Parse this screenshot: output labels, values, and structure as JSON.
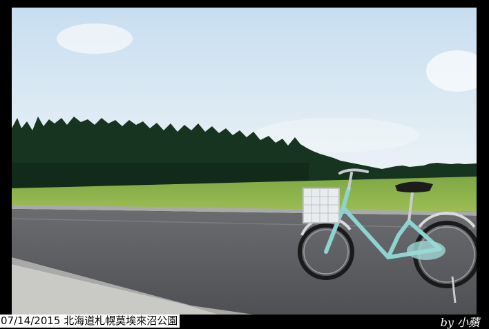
{
  "caption": {
    "text": "07/14/2015 北海道札幌莫埃來沼公園"
  },
  "signature": {
    "text": "by 小蘋"
  },
  "photo": {
    "colors": {
      "sky_top": "#d4e7f5",
      "sky_bottom": "#eef4f8",
      "trees": "#15301c",
      "grass": "#8db34a",
      "road": "#5a5c60",
      "sidewalk": "#c9c9c6",
      "bicycle_frame": "#8fd3cf",
      "basket": "#e8ecef",
      "tire": "#1a1a1a"
    }
  }
}
